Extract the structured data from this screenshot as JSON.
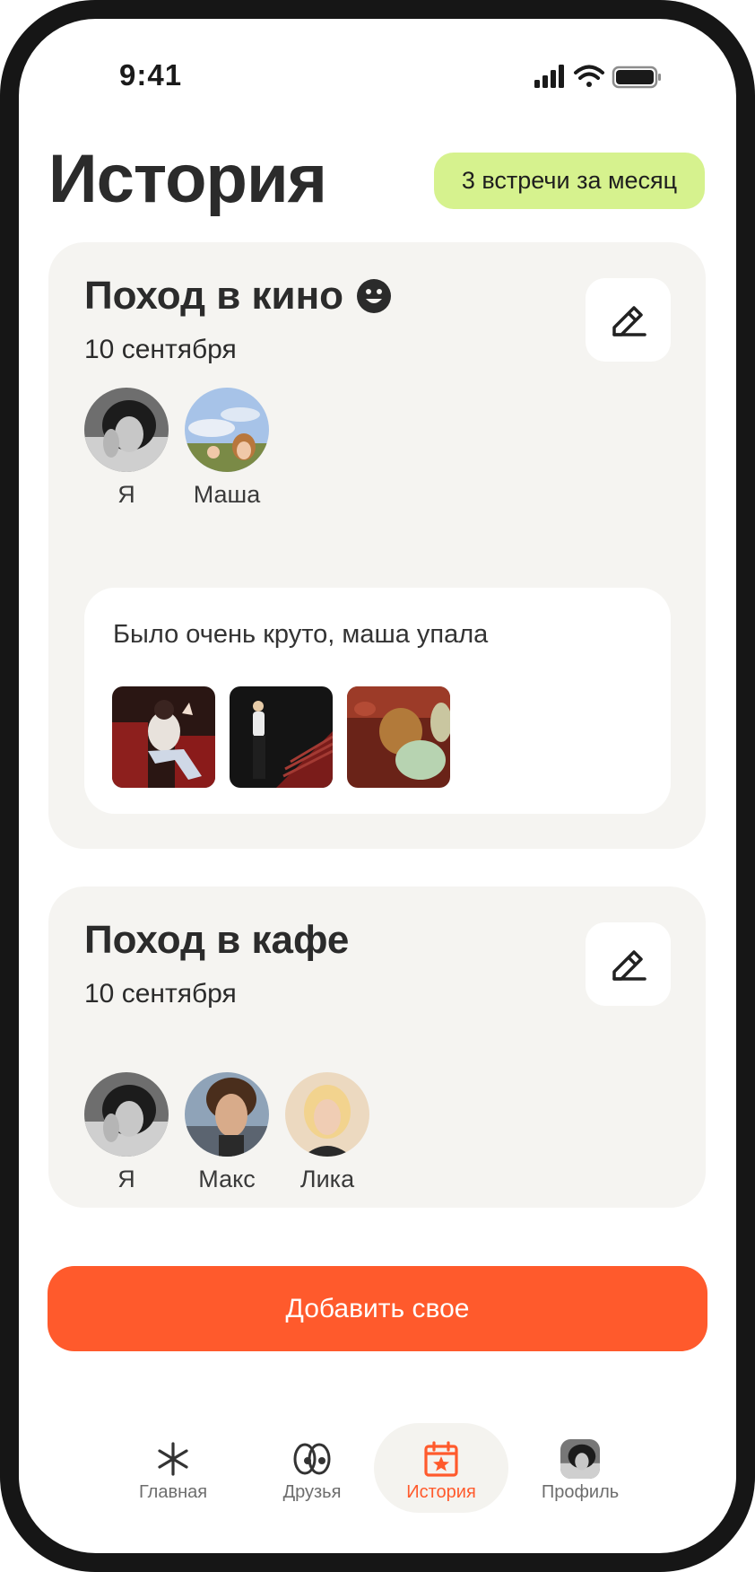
{
  "status_bar": {
    "time": "9:41"
  },
  "header": {
    "title": "История",
    "badge": "3 встречи за месяц"
  },
  "meetings": [
    {
      "title": "Поход в кино",
      "title_emoji_icon": "smiley-icon",
      "date": "10 сентября",
      "participants": [
        {
          "name": "Я"
        },
        {
          "name": "Маша"
        }
      ],
      "note": "Было очень круто, маша упала",
      "photos_count": 3
    },
    {
      "title": "Поход в кафе",
      "date": "10 сентября",
      "participants": [
        {
          "name": "Я"
        },
        {
          "name": "Макс"
        },
        {
          "name": "Лика"
        }
      ]
    }
  ],
  "add_button": {
    "label": "Добавить свое"
  },
  "bottom_nav": {
    "items": [
      {
        "label": "Главная",
        "icon": "asterisk-icon"
      },
      {
        "label": "Друзья",
        "icon": "friends-icon"
      },
      {
        "label": "История",
        "icon": "calendar-star-icon",
        "active": true
      },
      {
        "label": "Профиль",
        "icon": "profile-avatar"
      }
    ]
  },
  "colors": {
    "accent": "#ff5a2c",
    "badge_bg": "#d6f28e",
    "card_bg": "#f5f4f1",
    "frame": "#161616"
  }
}
